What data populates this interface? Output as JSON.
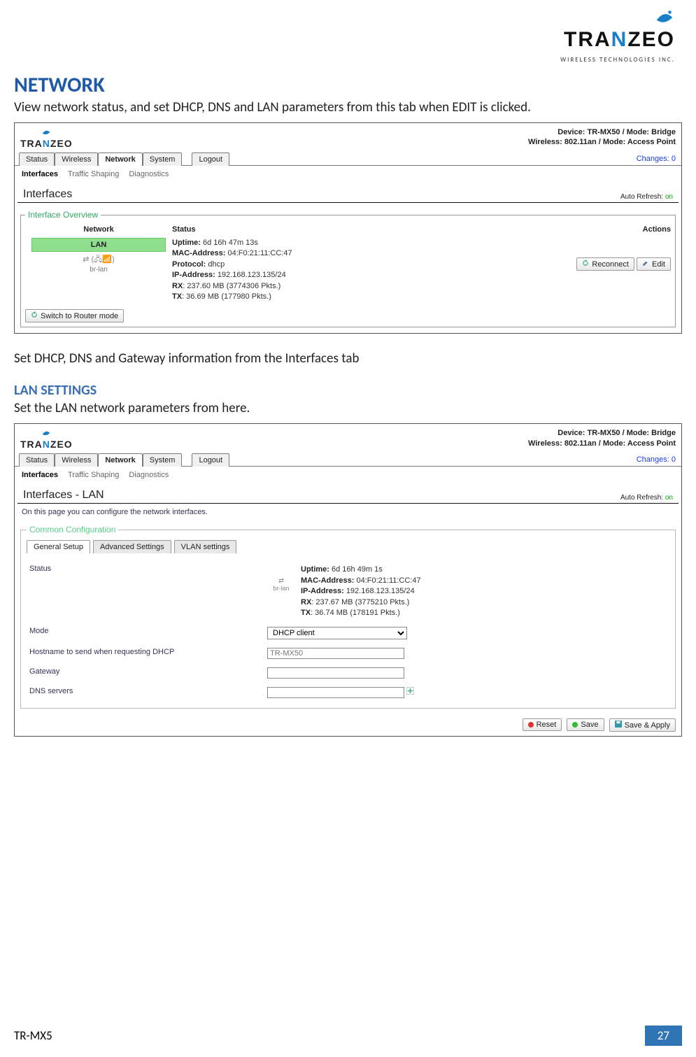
{
  "brand": {
    "name_pre": "TRA",
    "name_n": "N",
    "name_post": "ZEO",
    "subline": "WIRELESS  TECHNOLOGIES INC."
  },
  "page": {
    "h1": "NETWORK",
    "intro": "View network status, and set DHCP, DNS and LAN parameters from this tab when EDIT is clicked.",
    "mid": "Set DHCP, DNS and Gateway information from the Interfaces tab",
    "h2": "LAN SETTINGS",
    "lan_intro": "Set the LAN network parameters from here.",
    "footer_model": "TR-MX5",
    "footer_page": "27"
  },
  "dev": {
    "line1": "Device: TR-MX50 / Mode: Bridge",
    "line2": "Wireless: 802.11an / Mode: Access Point"
  },
  "main_tabs": {
    "status": "Status",
    "wireless": "Wireless",
    "network": "Network",
    "system": "System",
    "logout": "Logout"
  },
  "changes": "Changes: 0",
  "sub_tabs": {
    "interfaces": "Interfaces",
    "traffic": "Traffic Shaping",
    "diag": "Diagnostics"
  },
  "panel1": {
    "title": "Interfaces",
    "auto_refresh": "Auto Refresh:",
    "auto_refresh_state": "on",
    "legend": "Interface Overview",
    "head_network": "Network",
    "head_status": "Status",
    "head_actions": "Actions",
    "lan_label": "LAN",
    "brlan": "br-lan",
    "status": {
      "uptime_k": "Uptime:",
      "uptime_v": "6d 16h 47m 13s",
      "mac_k": "MAC-Address:",
      "mac_v": "04:F0:21:11:CC:47",
      "proto_k": "Protocol:",
      "proto_v": "dhcp",
      "ip_k": "IP-Address:",
      "ip_v": "192.168.123.135/24",
      "rx_k": "RX",
      "rx_v": ": 237.60 MB (3774306 Pkts.)",
      "tx_k": "TX",
      "tx_v": ": 36.69 MB (177980 Pkts.)"
    },
    "btn_reconnect": "Reconnect",
    "btn_edit": "Edit",
    "btn_switch": "Switch to Router mode"
  },
  "panel2": {
    "title": "Interfaces - LAN",
    "auto_refresh": "Auto Refresh:",
    "auto_refresh_state": "on",
    "desc": "On this page you can configure the network interfaces.",
    "legend": "Common Configuration",
    "inner_tabs": {
      "general": "General Setup",
      "advanced": "Advanced Settings",
      "vlan": "VLAN settings"
    },
    "rows": {
      "status": "Status",
      "mode": "Mode",
      "hostname": "Hostname to send when requesting DHCP",
      "gateway": "Gateway",
      "dns": "DNS servers"
    },
    "brlan": "br-lan",
    "status_block": {
      "uptime_k": "Uptime:",
      "uptime_v": "6d 16h 49m 1s",
      "mac_k": "MAC-Address:",
      "mac_v": "04:F0:21:11:CC:47",
      "ip_k": "IP-Address:",
      "ip_v": "192.168.123.135/24",
      "rx_k": "RX",
      "rx_v": ": 237.67 MB (3775210 Pkts.)",
      "tx_k": "TX",
      "tx_v": ": 36.74 MB (178191 Pkts.)"
    },
    "mode_value": "DHCP client",
    "hostname_placeholder": "TR-MX50",
    "gateway_value": "",
    "dns_value": "",
    "btn_reset": "Reset",
    "btn_save": "Save",
    "btn_saveapply": "Save & Apply"
  }
}
